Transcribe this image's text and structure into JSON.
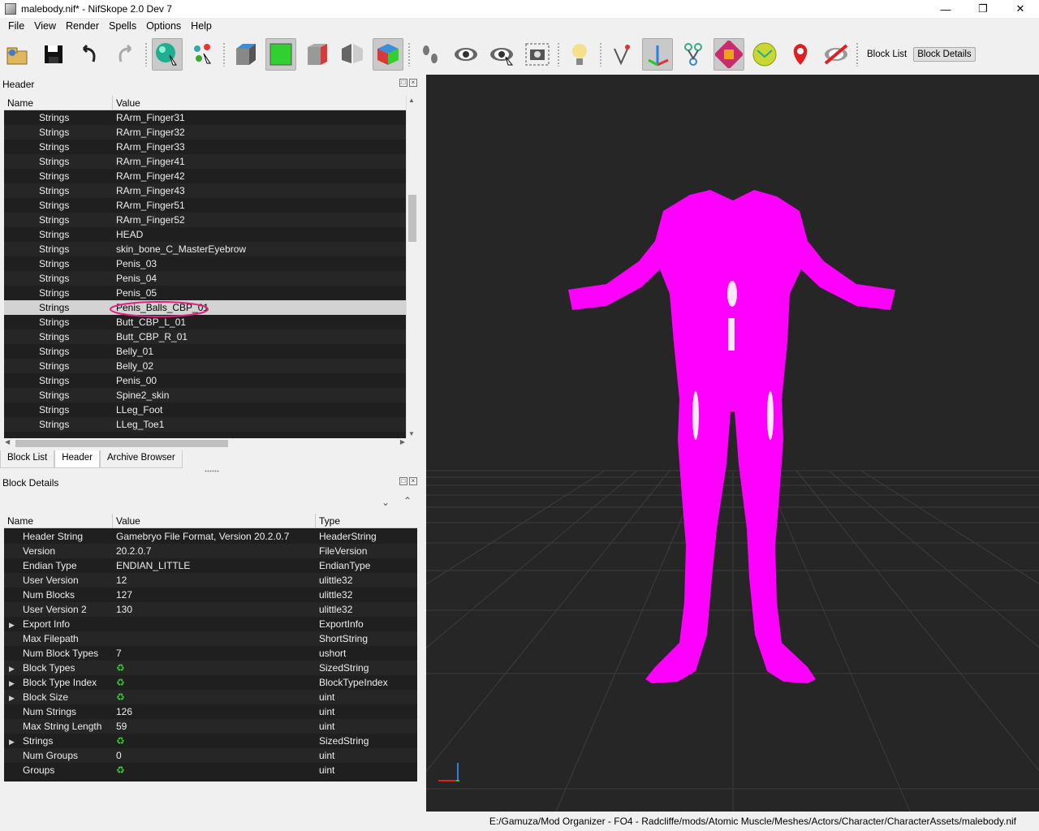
{
  "window": {
    "title": "malebody.nif* - NifSkope 2.0 Dev 7"
  },
  "menu": [
    "File",
    "View",
    "Render",
    "Spells",
    "Options",
    "Help"
  ],
  "toolbar": {
    "icons": [
      "load-icon",
      "save-icon",
      "undo-icon",
      "redo-icon",
      "select-object-icon",
      "select-vertex-icon",
      "view-top-icon",
      "view-front-icon",
      "view-side-icon",
      "view-user-icon",
      "view-perspective-icon",
      "walk-mode-icon",
      "show-hidden-icon",
      "show-nodes-icon",
      "screenshot-icon",
      "lighting-icon",
      "flip-icon",
      "axes-icon",
      "skeleton-icon",
      "texture-icon",
      "vertex-colors-icon",
      "markers-icon",
      "hide-icon"
    ],
    "block_list_label": "Block List",
    "block_details_label": "Block Details"
  },
  "header_pane": {
    "title": "Header",
    "columns": [
      "Name",
      "Value"
    ],
    "rows": [
      {
        "name": "Strings",
        "value": "RArm_Finger31"
      },
      {
        "name": "Strings",
        "value": "RArm_Finger32"
      },
      {
        "name": "Strings",
        "value": "RArm_Finger33"
      },
      {
        "name": "Strings",
        "value": "RArm_Finger41"
      },
      {
        "name": "Strings",
        "value": "RArm_Finger42"
      },
      {
        "name": "Strings",
        "value": "RArm_Finger43"
      },
      {
        "name": "Strings",
        "value": "RArm_Finger51"
      },
      {
        "name": "Strings",
        "value": "RArm_Finger52"
      },
      {
        "name": "Strings",
        "value": "HEAD"
      },
      {
        "name": "Strings",
        "value": "skin_bone_C_MasterEyebrow"
      },
      {
        "name": "Strings",
        "value": "Penis_03"
      },
      {
        "name": "Strings",
        "value": "Penis_04"
      },
      {
        "name": "Strings",
        "value": "Penis_05"
      },
      {
        "name": "Strings",
        "value": "Penis_Balls_CBP_01",
        "selected": true
      },
      {
        "name": "Strings",
        "value": "Butt_CBP_L_01"
      },
      {
        "name": "Strings",
        "value": "Butt_CBP_R_01"
      },
      {
        "name": "Strings",
        "value": "Belly_01"
      },
      {
        "name": "Strings",
        "value": "Belly_02"
      },
      {
        "name": "Strings",
        "value": "Penis_00"
      },
      {
        "name": "Strings",
        "value": "Spine2_skin"
      },
      {
        "name": "Strings",
        "value": "LLeg_Foot"
      },
      {
        "name": "Strings",
        "value": "LLeg_Toe1"
      }
    ]
  },
  "tabs": [
    "Block List",
    "Header",
    "Archive Browser"
  ],
  "details_pane": {
    "title": "Block Details",
    "columns": [
      "Name",
      "Value",
      "Type"
    ],
    "rows": [
      {
        "name": "Header String",
        "value": "Gamebryo File Format, Version 20.2.0.7",
        "type": "HeaderString"
      },
      {
        "name": "Version",
        "value": "20.2.0.7",
        "type": "FileVersion"
      },
      {
        "name": "Endian Type",
        "value": "ENDIAN_LITTLE",
        "type": "EndianType"
      },
      {
        "name": "User Version",
        "value": "12",
        "type": "ulittle32"
      },
      {
        "name": "Num Blocks",
        "value": "127",
        "type": "ulittle32"
      },
      {
        "name": "User Version 2",
        "value": "130",
        "type": "ulittle32"
      },
      {
        "name": "Export Info",
        "value": "",
        "type": "ExportInfo",
        "expandable": true
      },
      {
        "name": "Max Filepath",
        "value": "",
        "type": "ShortString"
      },
      {
        "name": "Num Block Types",
        "value": "7",
        "type": "ushort"
      },
      {
        "name": "Block Types",
        "value": "",
        "type": "SizedString",
        "expandable": true,
        "array": true
      },
      {
        "name": "Block Type Index",
        "value": "",
        "type": "BlockTypeIndex",
        "expandable": true,
        "array": true
      },
      {
        "name": "Block Size",
        "value": "",
        "type": "uint",
        "expandable": true,
        "array": true
      },
      {
        "name": "Num Strings",
        "value": "126",
        "type": "uint"
      },
      {
        "name": "Max String Length",
        "value": "59",
        "type": "uint"
      },
      {
        "name": "Strings",
        "value": "",
        "type": "SizedString",
        "expandable": true,
        "array": true
      },
      {
        "name": "Num Groups",
        "value": "0",
        "type": "uint"
      },
      {
        "name": "Groups",
        "value": "",
        "type": "uint",
        "array": true
      }
    ]
  },
  "status": {
    "path": "E:/Gamuza/Mod Organizer - FO4 - Radcliffe/mods/Atomic Muscle/Meshes/Actors/Character/CharacterAssets/malebody.nif"
  },
  "colors": {
    "model": "#ff00ff",
    "viewport_bg": "#262626",
    "selection": "#d3d3d3",
    "annotation": "#e0207f"
  }
}
